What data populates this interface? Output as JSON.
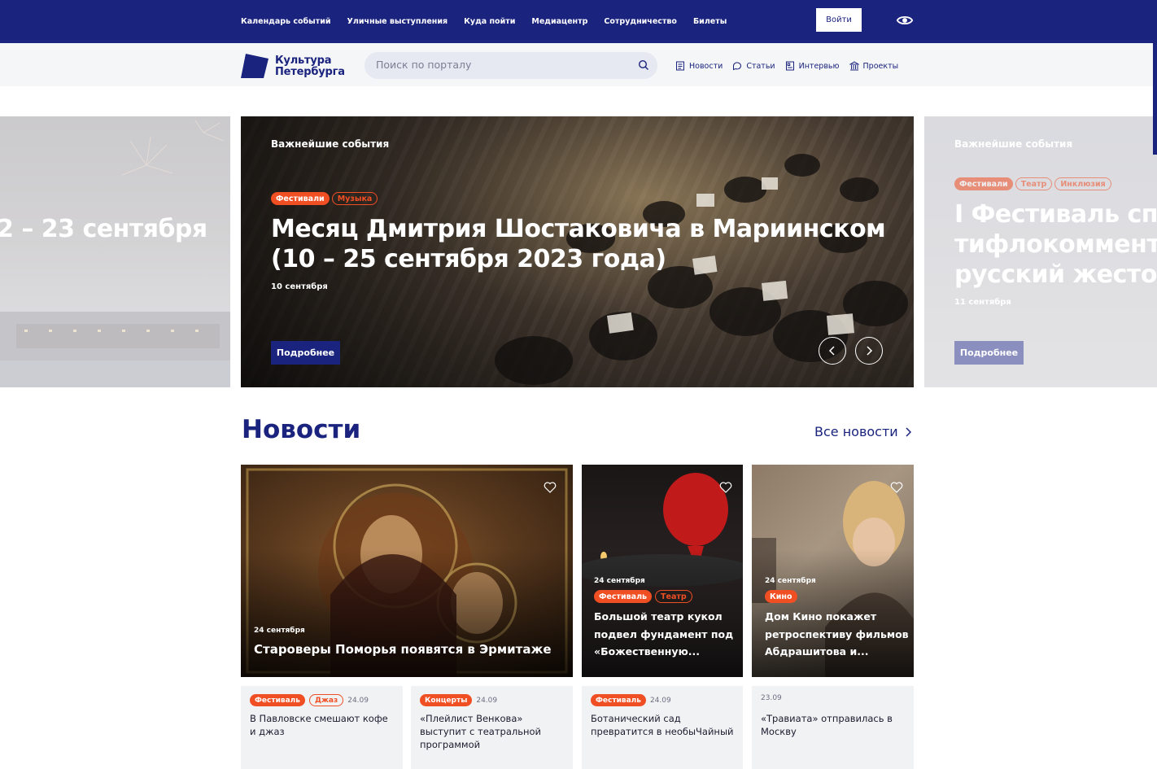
{
  "topnav": {
    "items": [
      "Календарь событий",
      "Уличные выступления",
      "Куда пойти",
      "Медиацентр",
      "Сотрудничество",
      "Билеты"
    ],
    "login": "Войти"
  },
  "header": {
    "logo_line1": "Культура",
    "logo_line2": "Петербурга",
    "search_placeholder": "Поиск по порталу",
    "subnav": [
      "Новости",
      "Статьи",
      "Интервью",
      "Проекты"
    ]
  },
  "carousel": {
    "left": {
      "title": "2 – 23 сентября"
    },
    "main": {
      "label": "Важнейшие события",
      "tags": [
        "Фестивали",
        "Музыка"
      ],
      "title_line1": "Месяц Дмитрия Шостаковича в Мариинском",
      "title_line2": "(10 – 25 сентября 2023 года)",
      "date": "10 сентября",
      "button": "Подробнее"
    },
    "right": {
      "label": "Важнейшие события",
      "tags": [
        "Фестивали",
        "Театр",
        "Инклюзия"
      ],
      "title_line1": "I Фестиваль спе",
      "title_line2": "тифлокомменти",
      "title_line3": "русский жестов",
      "date": "11 сентября",
      "button": "Подробнее"
    }
  },
  "news": {
    "title": "Новости",
    "all": "Все новости",
    "cards": [
      {
        "date": "24 сентября",
        "title": "Староверы Поморья появятся в Эрмитаже",
        "tags": []
      },
      {
        "date": "24 сентября",
        "tags": [
          "Фестиваль",
          "Театр"
        ],
        "title_l1": "Большой театр кукол",
        "title_l2": "подвел фундамент под",
        "title_l3": "«Божественную..."
      },
      {
        "date": "24 сентября",
        "tags": [
          "Кино"
        ],
        "title_l1": "Дом Кино покажет",
        "title_l2": "ретроспективу фильмов",
        "title_l3": "Абдрашитова и..."
      }
    ],
    "mini": [
      {
        "tags": [
          "Фестиваль",
          "Джаз"
        ],
        "date": "24.09",
        "title_l1": "В Павловске смешают кофе",
        "title_l2": "и джаз"
      },
      {
        "tags": [
          "Концерты"
        ],
        "date": "24.09",
        "title_l1": "«Плейлист Венкова»",
        "title_l2": "выступит с театральной",
        "title_l3": "программой"
      },
      {
        "tags": [
          "Фестиваль"
        ],
        "date": "24.09",
        "title_l1": "Ботанический сад",
        "title_l2": "превратится в необыЧайный"
      },
      {
        "tags": [],
        "date": "23.09",
        "title_l1": "«Травиата» отправилась в",
        "title_l2": "Москву"
      }
    ]
  }
}
